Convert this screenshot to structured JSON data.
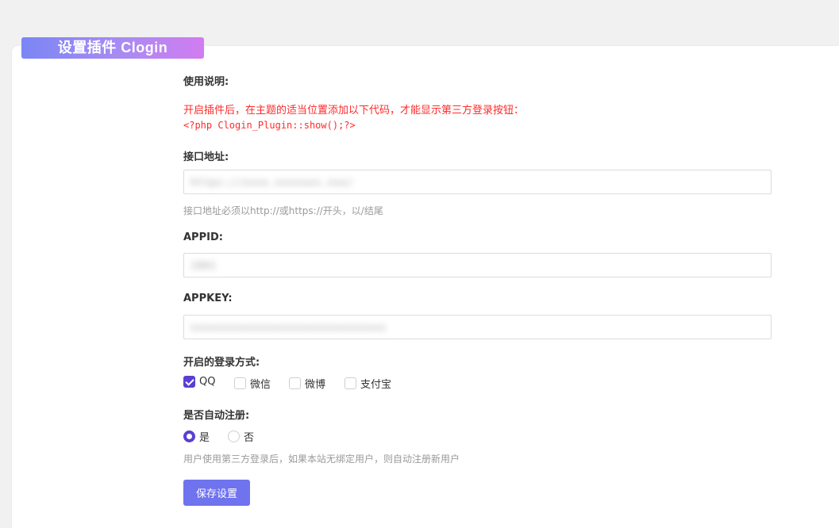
{
  "header": {
    "title": "设置插件 Clogin"
  },
  "usage": {
    "label": "使用说明:",
    "instruction": "开启插件后，在主题的适当位置添加以下代码，才能显示第三方登录按钮：",
    "code": "<?php Clogin_Plugin::show();?>"
  },
  "api_url": {
    "label": "接口地址:",
    "value": "https://xxxx.xxxxxxx.xxx/",
    "hint": "接口地址必须以http://或https://开头，以/结尾"
  },
  "appid": {
    "label": "APPID:",
    "value": "1001"
  },
  "appkey": {
    "label": "APPKEY:",
    "value": "xxxxxxxxxxxxxxxxxxxxxxxxxxxxxx"
  },
  "login_methods": {
    "label": "开启的登录方式:",
    "options": [
      {
        "label": "QQ",
        "checked": true
      },
      {
        "label": "微信",
        "checked": false
      },
      {
        "label": "微博",
        "checked": false
      },
      {
        "label": "支付宝",
        "checked": false
      }
    ]
  },
  "auto_register": {
    "label": "是否自动注册:",
    "options": [
      {
        "label": "是",
        "selected": true
      },
      {
        "label": "否",
        "selected": false
      }
    ],
    "hint": "用户使用第三方登录后，如果本站无绑定用户，则自动注册新用户"
  },
  "save_button": {
    "label": "保存设置"
  },
  "colors": {
    "accent": "#5b3fd1",
    "button": "#6f73ee",
    "warning": "#ff2a2a"
  }
}
